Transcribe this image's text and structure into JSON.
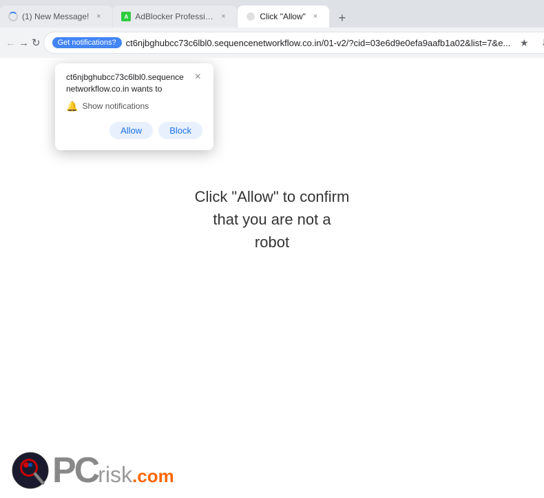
{
  "window": {
    "title": "Click \"Allow\""
  },
  "tabs": [
    {
      "id": "tab1",
      "label": "(1) New Message!",
      "favicon_type": "spinner",
      "active": false
    },
    {
      "id": "tab2",
      "label": "AdBlocker Professional",
      "favicon_color": "#2ecc40",
      "active": false
    },
    {
      "id": "tab3",
      "label": "Click \"Allow\"",
      "active": true
    }
  ],
  "toolbar": {
    "notification_badge": "Get notifications?",
    "address": "ct6njbghubcc73c6lbl0.sequencenetworkflow.co.in/01-v2/?cid=03e6d9e0efa9aafb1a02&list=7&e..."
  },
  "notification_popup": {
    "title": "ct6njbghubcc73c6lbl0.sequence networkflow.co.in wants to",
    "show_notifications_label": "Show notifications",
    "allow_button": "Allow",
    "block_button": "Block"
  },
  "page": {
    "main_text_line1": "Click \"Allow\" to confirm",
    "main_text_line2": "that you are not a",
    "main_text_line3": "robot"
  },
  "logo": {
    "site": "PCrisk",
    "domain": ".com"
  }
}
